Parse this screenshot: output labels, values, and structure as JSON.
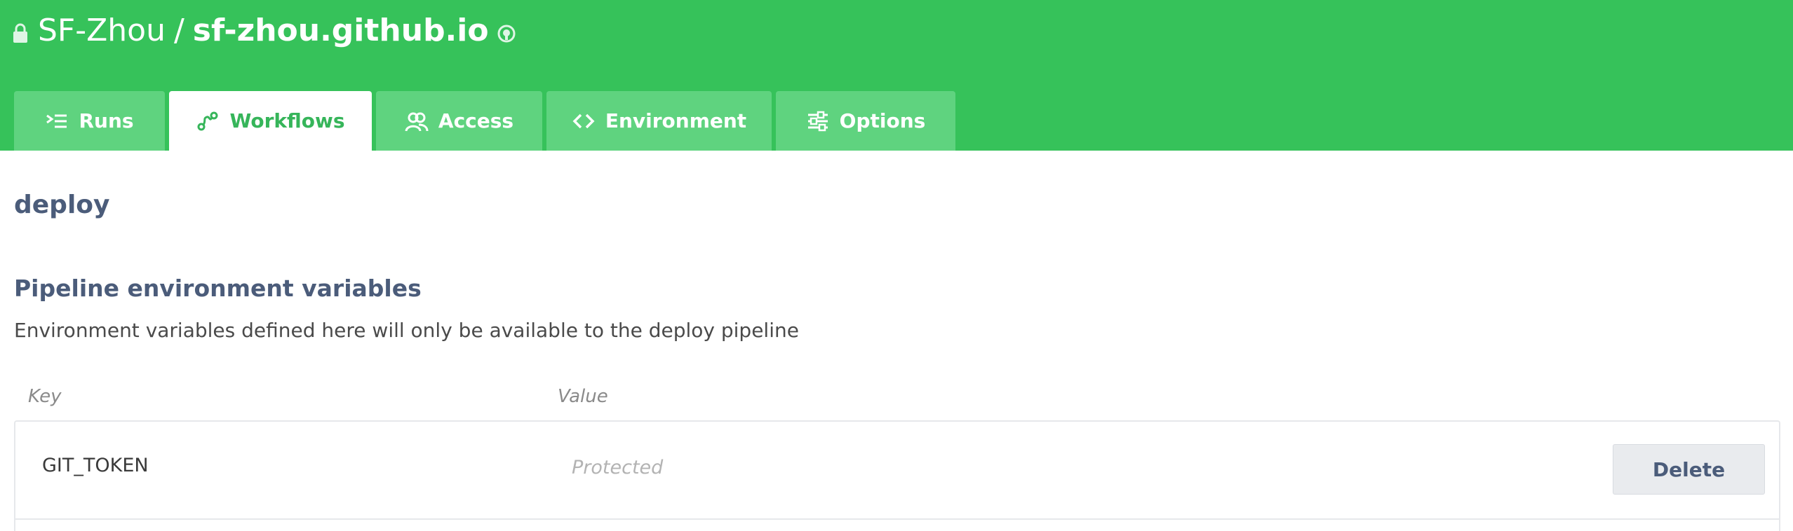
{
  "header": {
    "owner": "SF-Zhou",
    "separator": "/",
    "repo": "sf-zhou.github.io",
    "lock_icon": "lock-icon",
    "github_icon": "github-icon",
    "background_color": "#36c25a"
  },
  "tabs": [
    {
      "label": "Runs",
      "icon": "runs-icon",
      "active": false
    },
    {
      "label": "Workflows",
      "icon": "workflows-icon",
      "active": true
    },
    {
      "label": "Access",
      "icon": "access-icon",
      "active": false
    },
    {
      "label": "Environment",
      "icon": "code-brackets-icon",
      "active": false
    },
    {
      "label": "Options",
      "icon": "options-icon",
      "active": false
    }
  ],
  "workflow": {
    "name": "deploy"
  },
  "env_section": {
    "title": "Pipeline environment variables",
    "description": "Environment variables defined here will only be available to the deploy pipeline",
    "columns": {
      "key": "Key",
      "value": "Value"
    },
    "rows": [
      {
        "key": "GIT_TOKEN",
        "value": "Protected",
        "action": "Delete"
      }
    ]
  },
  "colors": {
    "accent": "#36c25a",
    "tab_inactive": "#5fd37f",
    "heading": "#4b5c7a"
  }
}
